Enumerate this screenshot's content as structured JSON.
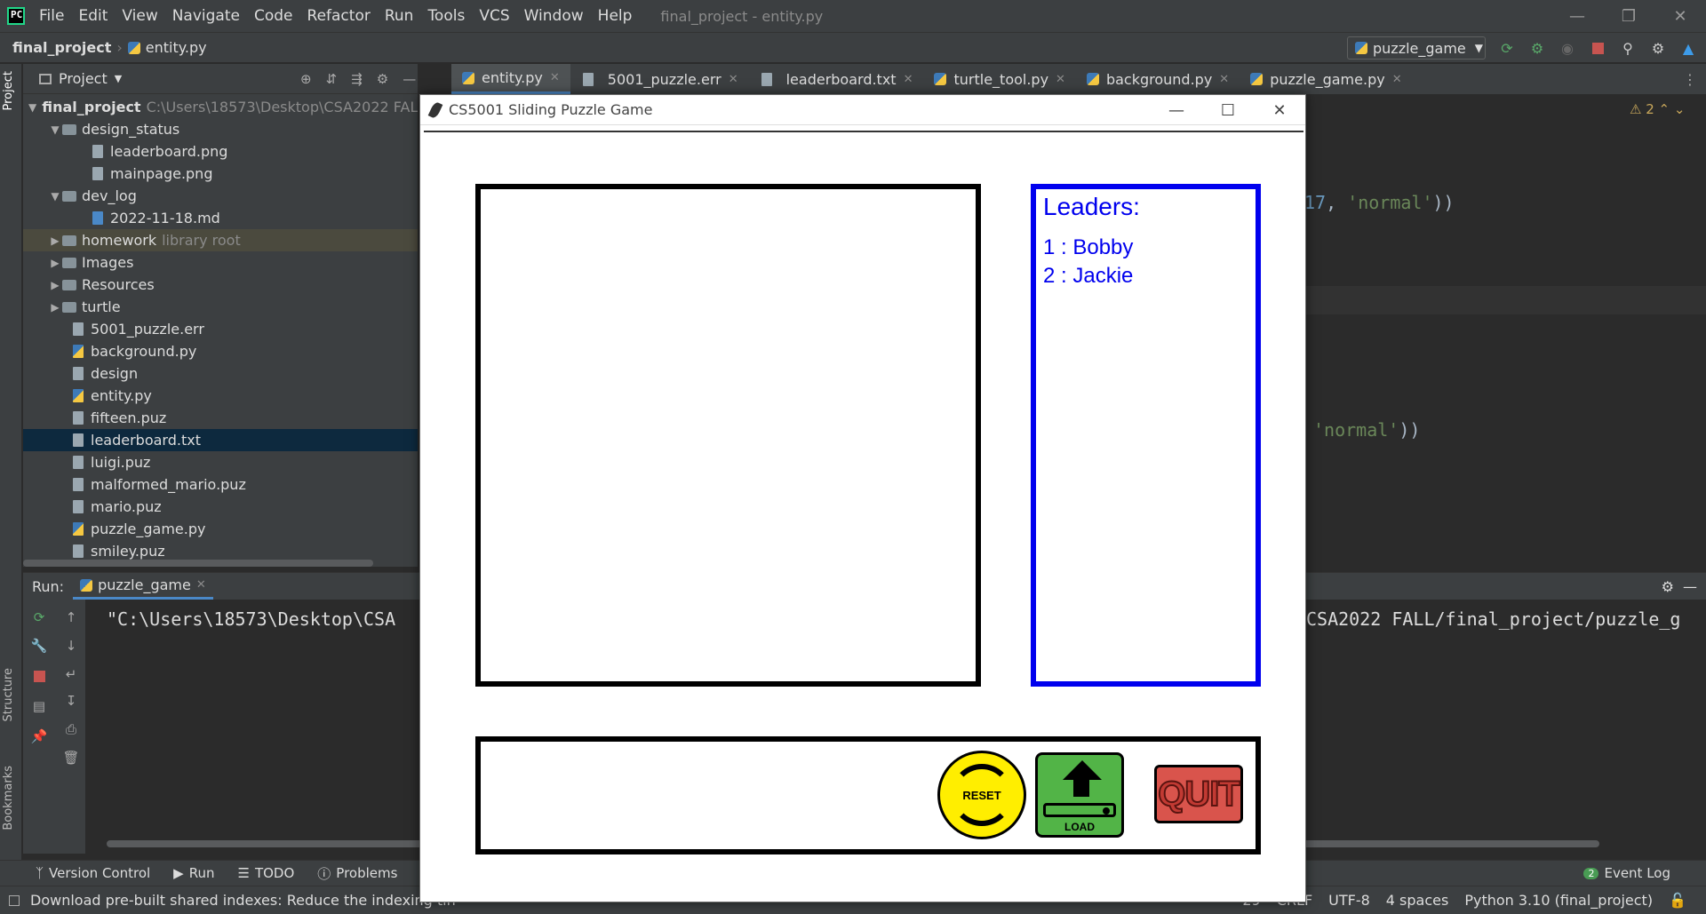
{
  "app": {
    "window_title": "final_project - entity.py",
    "menu": [
      "File",
      "Edit",
      "View",
      "Navigate",
      "Code",
      "Refactor",
      "Run",
      "Tools",
      "VCS",
      "Window",
      "Help"
    ]
  },
  "breadcrumb": {
    "project": "final_project",
    "file": "entity.py"
  },
  "run_config": {
    "name": "puzzle_game"
  },
  "project_panel": {
    "title": "Project",
    "root_name": "final_project",
    "root_path": "C:\\Users\\18573\\Desktop\\CSA2022 FALL",
    "items": [
      {
        "label": "design_status",
        "hint": ""
      },
      {
        "label": "leaderboard.png",
        "hint": ""
      },
      {
        "label": "mainpage.png",
        "hint": ""
      },
      {
        "label": "dev_log",
        "hint": ""
      },
      {
        "label": "2022-11-18.md",
        "hint": ""
      },
      {
        "label": "homework",
        "hint": "library root"
      },
      {
        "label": "Images",
        "hint": ""
      },
      {
        "label": "Resources",
        "hint": ""
      },
      {
        "label": "turtle",
        "hint": ""
      },
      {
        "label": "5001_puzzle.err",
        "hint": ""
      },
      {
        "label": "background.py",
        "hint": ""
      },
      {
        "label": "design",
        "hint": ""
      },
      {
        "label": "entity.py",
        "hint": ""
      },
      {
        "label": "fifteen.puz",
        "hint": ""
      },
      {
        "label": "leaderboard.txt",
        "hint": ""
      },
      {
        "label": "luigi.puz",
        "hint": ""
      },
      {
        "label": "malformed_mario.puz",
        "hint": ""
      },
      {
        "label": "mario.puz",
        "hint": ""
      },
      {
        "label": "puzzle_game.py",
        "hint": ""
      },
      {
        "label": "smiley.puz",
        "hint": ""
      }
    ]
  },
  "editor_tabs": [
    "entity.py",
    "5001_puzzle.err",
    "leaderboard.txt",
    "turtle_tool.py",
    "background.py",
    "puzzle_game.py"
  ],
  "editor": {
    "line1_num": "17",
    "line1_str": "'normal'",
    "line2_str": "'normal'",
    "warning_count": "2"
  },
  "run_panel": {
    "label": "Run:",
    "tab": "puzzle_game",
    "console_left": "\"C:\\Users\\18573\\Desktop\\CSA",
    "console_right": "CSA2022 FALL/final_project/puzzle_g"
  },
  "side_tabs": {
    "project": "Project",
    "structure": "Structure",
    "bookmarks": "Bookmarks"
  },
  "bottom_tools": [
    "Version Control",
    "Run",
    "TODO",
    "Problems"
  ],
  "event_log": {
    "label": "Event Log",
    "count": "2"
  },
  "status": {
    "message": "Download pre-built shared indexes: Reduce the indexing tin",
    "position": "29",
    "line_sep": "CRLF",
    "encoding": "UTF-8",
    "indent": "4 spaces",
    "interpreter": "Python 3.10 (final_project)"
  },
  "game": {
    "window_title": "CS5001 Sliding Puzzle Game",
    "leaders_title": "Leaders:",
    "leaders": [
      "1 : Bobby",
      "2 : Jackie"
    ],
    "reset_label": "RESET",
    "load_label": "LOAD",
    "quit_label": "QUIT"
  },
  "colors": {
    "leaders_blue": "#0000ee",
    "reset_yellow": "#ffee00",
    "load_green": "#52b447",
    "quit_red": "#d9544c"
  }
}
